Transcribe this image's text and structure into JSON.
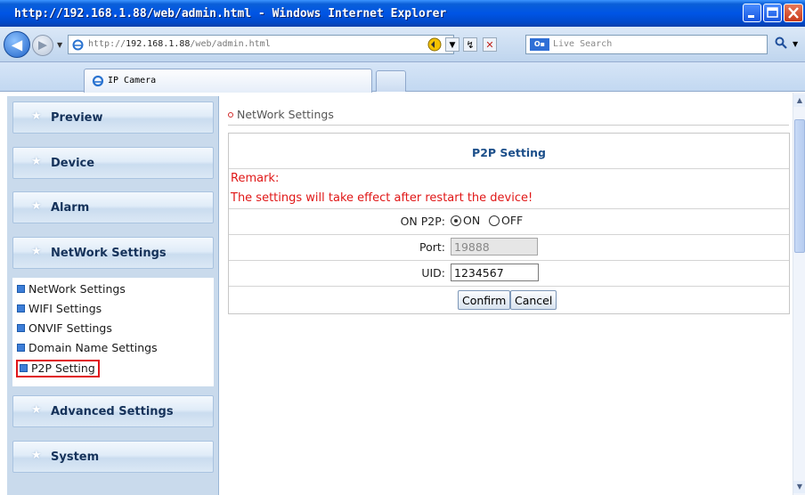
{
  "window": {
    "title": "http://192.168.1.88/web/admin.html - Windows Internet Explorer"
  },
  "address_bar": {
    "url_prefix": "http://",
    "url_host": "192.168.1.88",
    "url_path": "/web/admin.html",
    "search_placeholder": "Live Search"
  },
  "tabs": [
    {
      "label": "IP Camera",
      "active": true
    }
  ],
  "sidebar": {
    "sections": [
      {
        "label": "Preview"
      },
      {
        "label": "Device"
      },
      {
        "label": "Alarm"
      },
      {
        "label": "NetWork Settings"
      },
      {
        "label": "Advanced Settings"
      },
      {
        "label": "System"
      }
    ],
    "submenu": [
      {
        "label": "NetWork Settings"
      },
      {
        "label": "WIFI Settings"
      },
      {
        "label": "ONVIF Settings"
      },
      {
        "label": "Domain Name Settings"
      },
      {
        "label": "P2P Setting",
        "selected": true
      }
    ]
  },
  "main": {
    "breadcrumb": "NetWork Settings",
    "panel_title": "P2P Setting",
    "remark_heading": "Remark:",
    "remark_text": "The settings will take effect after restart the device!",
    "fields": {
      "on_p2p": {
        "label": "ON P2P:",
        "options": [
          "ON",
          "OFF"
        ],
        "selected": "ON"
      },
      "port": {
        "label": "Port:",
        "value": "19888",
        "disabled": true
      },
      "uid": {
        "label": "UID:",
        "value": "1234567"
      }
    },
    "buttons": {
      "confirm": "Confirm",
      "cancel": "Cancel"
    }
  },
  "colors": {
    "remark_red": "#e01717",
    "title_blue": "#1c4f8a",
    "sidebar_bg": "#c9daec",
    "selection_outline": "#e0151a"
  }
}
